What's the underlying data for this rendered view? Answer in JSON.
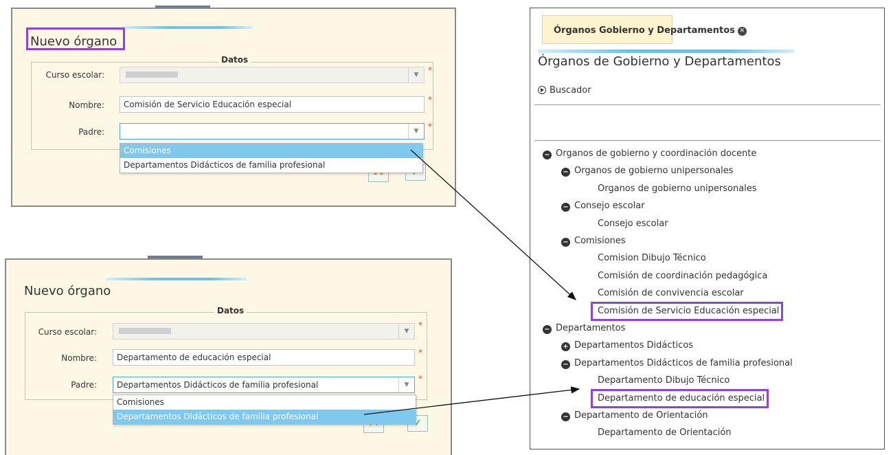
{
  "dialog_top": {
    "title": "Nuevo órgano",
    "fieldset_legend": "Datos",
    "labels": {
      "curso": "Curso escolar:",
      "nombre": "Nombre:",
      "padre": "Padre:"
    },
    "nombre_value": "Comisión de Servicio Educación especial",
    "padre_value": "",
    "required_mark": "*",
    "dropdown_options": [
      "Comisiones",
      "Departamentos Didácticos de familia profesional"
    ],
    "selected_option_index": 0
  },
  "dialog_bottom": {
    "title": "Nuevo órgano",
    "fieldset_legend": "Datos",
    "labels": {
      "curso": "Curso escolar:",
      "nombre": "Nombre:",
      "padre": "Padre:"
    },
    "nombre_value": "Departamento de educación especial",
    "padre_value": "Departamentos Didácticos de familia profesional",
    "required_mark": "*",
    "dropdown_options": [
      "Comisiones",
      "Departamentos Didácticos de familia profesional"
    ],
    "selected_option_index": 1
  },
  "right_panel": {
    "tab_label": "Órganos Gobierno y Departamentos",
    "page_title": "Órganos de Gobierno y Departamentos",
    "search_label": "Buscador",
    "tree": [
      {
        "label": "Organos de gobierno y coordinación docente",
        "level": 0,
        "toggle": "minus"
      },
      {
        "label": "Organos de gobierno unipersonales",
        "level": 1,
        "toggle": "minus"
      },
      {
        "label": "Organos de gobierno unipersonales",
        "level": 2,
        "toggle": ""
      },
      {
        "label": "Consejo escolar",
        "level": 1,
        "toggle": "minus"
      },
      {
        "label": "Consejo escolar",
        "level": 2,
        "toggle": ""
      },
      {
        "label": "Comisiones",
        "level": 1,
        "toggle": "minus"
      },
      {
        "label": "Comision Dibujo Técnico",
        "level": 2,
        "toggle": ""
      },
      {
        "label": "Comisión de coordinación pedagógica",
        "level": 2,
        "toggle": ""
      },
      {
        "label": "Comisión de convivencia escolar",
        "level": 2,
        "toggle": ""
      },
      {
        "label": "Comisión de Servicio Educación especial",
        "level": 2,
        "toggle": "",
        "highlight": true
      },
      {
        "label": "Departamentos",
        "level": 0,
        "toggle": "minus"
      },
      {
        "label": "Departamentos Didácticos",
        "level": 1,
        "toggle": "plus"
      },
      {
        "label": "Departamentos Didácticos de familia profesional",
        "level": 1,
        "toggle": "minus"
      },
      {
        "label": "Departamento Dibujo Técnico",
        "level": 2,
        "toggle": ""
      },
      {
        "label": "Departamento de educación especial",
        "level": 2,
        "toggle": "",
        "highlight": true
      },
      {
        "label": "Departamento de Orientación",
        "level": 1,
        "toggle": "minus"
      },
      {
        "label": "Departamento de Orientación",
        "level": 2,
        "toggle": ""
      }
    ]
  },
  "colors": {
    "highlight": "#8c44d9",
    "selection": "#7fc8ee",
    "dialog_bg": "#fdf8e6",
    "tab_bg": "#fdf3cf"
  }
}
